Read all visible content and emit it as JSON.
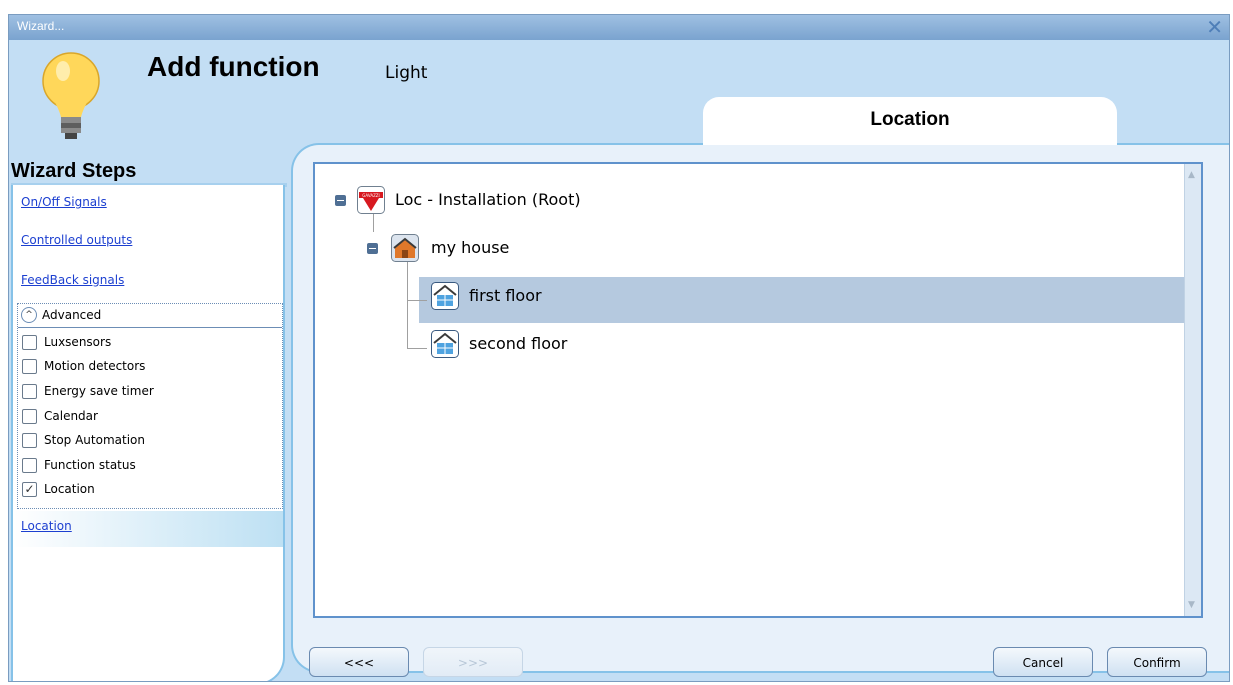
{
  "window": {
    "title": "Wizard...",
    "close_glyph": "✕"
  },
  "header": {
    "title": "Add function",
    "subtitle": "Light",
    "icon": "light-bulb-icon"
  },
  "tab": {
    "label": "Location"
  },
  "steps": {
    "heading": "Wizard Steps",
    "links": [
      "On/Off Signals",
      "Controlled outputs",
      "FeedBack signals"
    ],
    "advanced": {
      "label": "Advanced",
      "items": [
        {
          "label": "Luxsensors",
          "checked": false
        },
        {
          "label": "Motion detectors",
          "checked": false
        },
        {
          "label": "Energy save timer",
          "checked": false
        },
        {
          "label": "Calendar",
          "checked": false
        },
        {
          "label": "Stop Automation",
          "checked": false
        },
        {
          "label": "Function status",
          "checked": false
        },
        {
          "label": "Location",
          "checked": true
        }
      ]
    },
    "active_step": "Location"
  },
  "tree": {
    "nodes": [
      {
        "label": "Loc - Installation (Root)",
        "icon": "carlo-gavazzi-logo-icon",
        "logo_text": "GAVAZZI"
      },
      {
        "label": "my house",
        "icon": "house-icon"
      },
      {
        "label": "first floor",
        "icon": "floor-icon",
        "selected": true
      },
      {
        "label": "second floor",
        "icon": "floor-icon"
      }
    ]
  },
  "buttons": {
    "back": "<<<",
    "next": ">>>",
    "cancel": "Cancel",
    "confirm": "Confirm"
  },
  "colors": {
    "accent": "#86c2e8",
    "selection": "#b5c9df",
    "link": "#1c3fd0"
  }
}
